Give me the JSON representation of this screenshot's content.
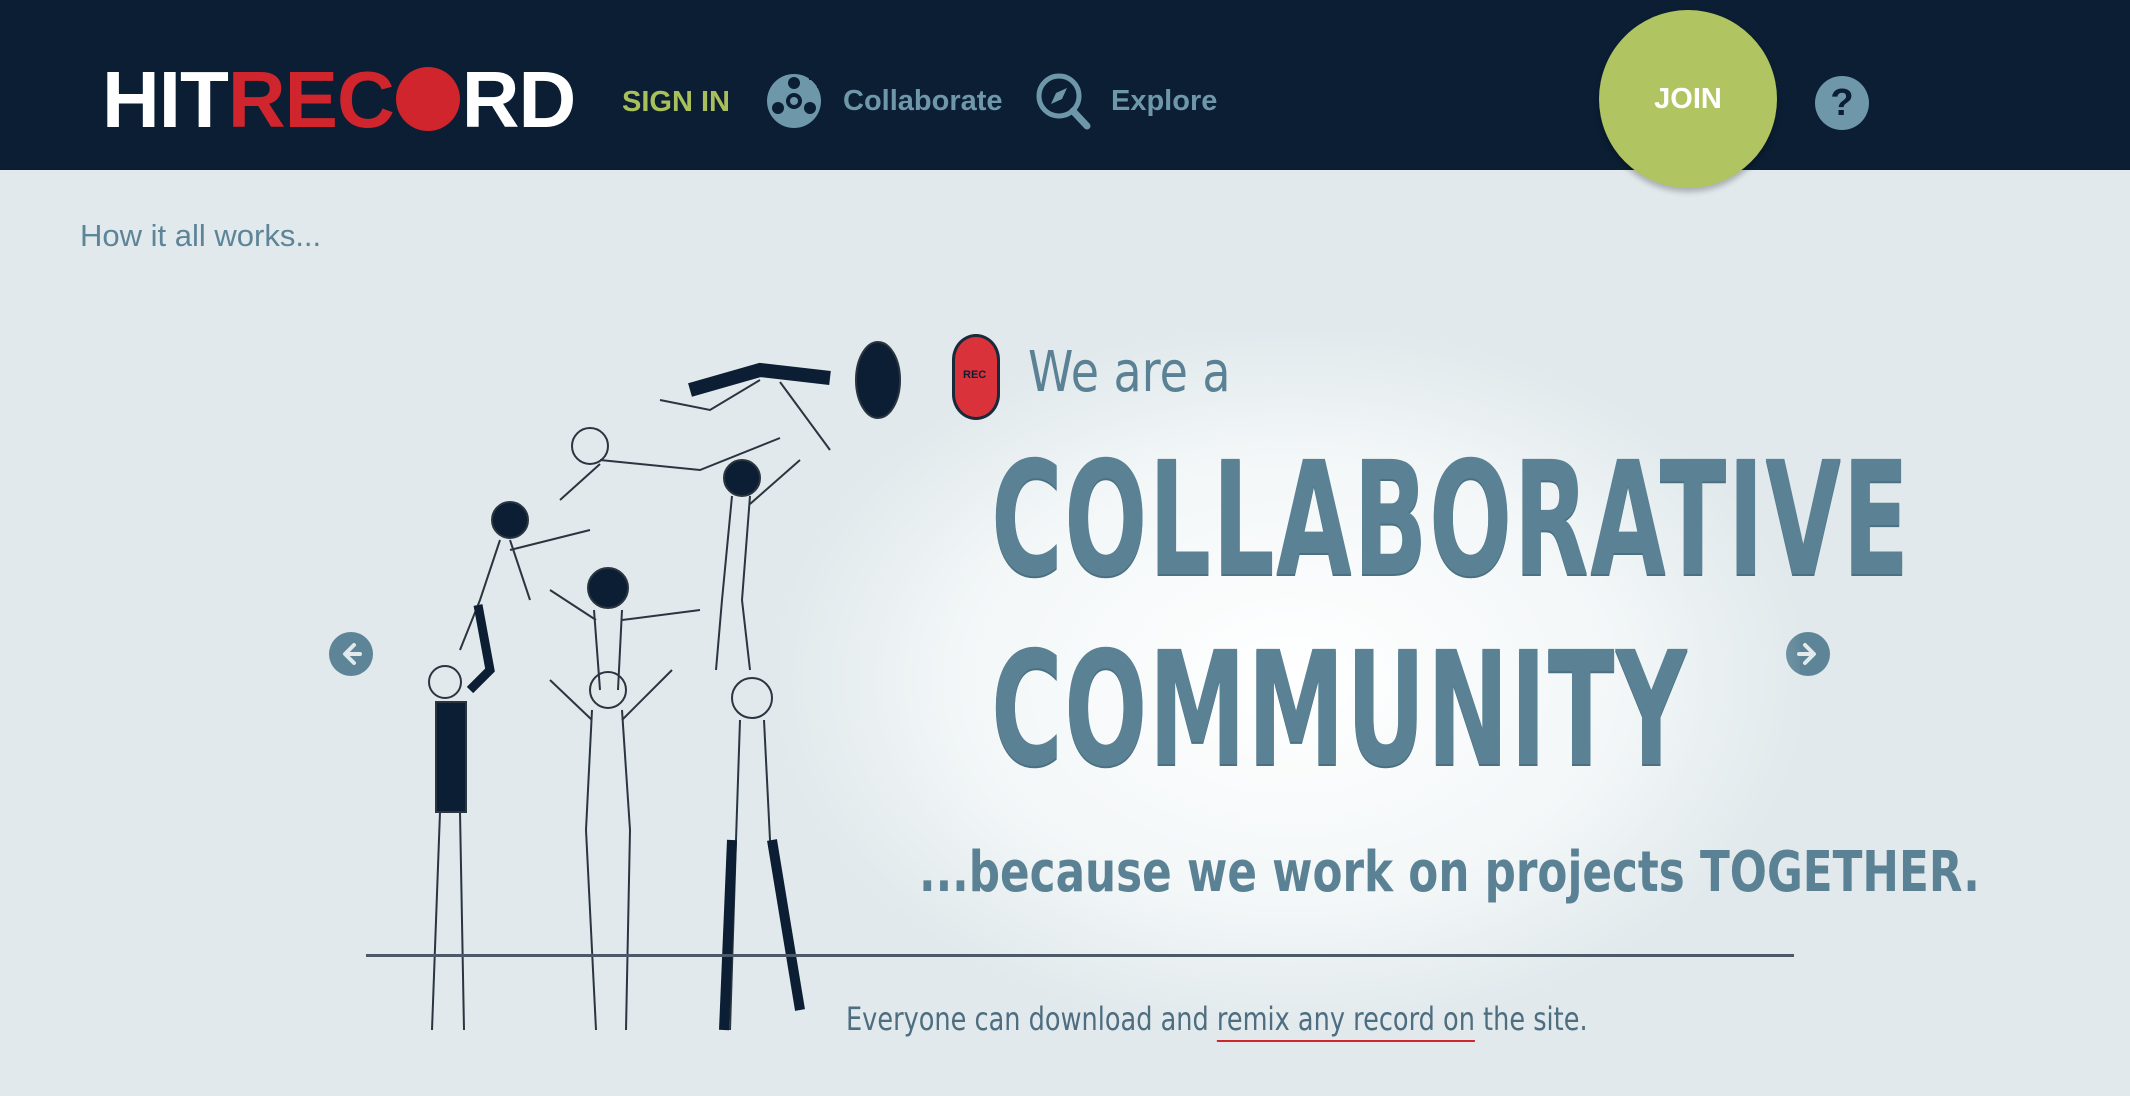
{
  "header": {
    "logo": {
      "part1": "HIT",
      "part2": "REC",
      "part3": "RD"
    },
    "sign_in": "SIGN IN",
    "collaborate": "Collaborate",
    "explore": "Explore",
    "join": "JOIN",
    "help": "?"
  },
  "section": {
    "title": "How it all works..."
  },
  "slide": {
    "we_are": "We are a",
    "line1": "COLLABORATIVE",
    "line2": "COMMUNITY",
    "because": "...because we work on projects TOGETHER.",
    "footer_pre": "Everyone can download and ",
    "footer_underlined": "remix any record on",
    "footer_post": " the site.",
    "rec_label": "REC"
  },
  "colors": {
    "topbar": "#0b1e33",
    "accent_green": "#b0c462",
    "brand_red": "#d1252e",
    "slate_blue": "#5a8194"
  },
  "icons": {
    "collaborate": "reel-icon",
    "explore": "compass-magnifier-icon",
    "prev": "arrow-left-icon",
    "next": "arrow-right-icon"
  }
}
